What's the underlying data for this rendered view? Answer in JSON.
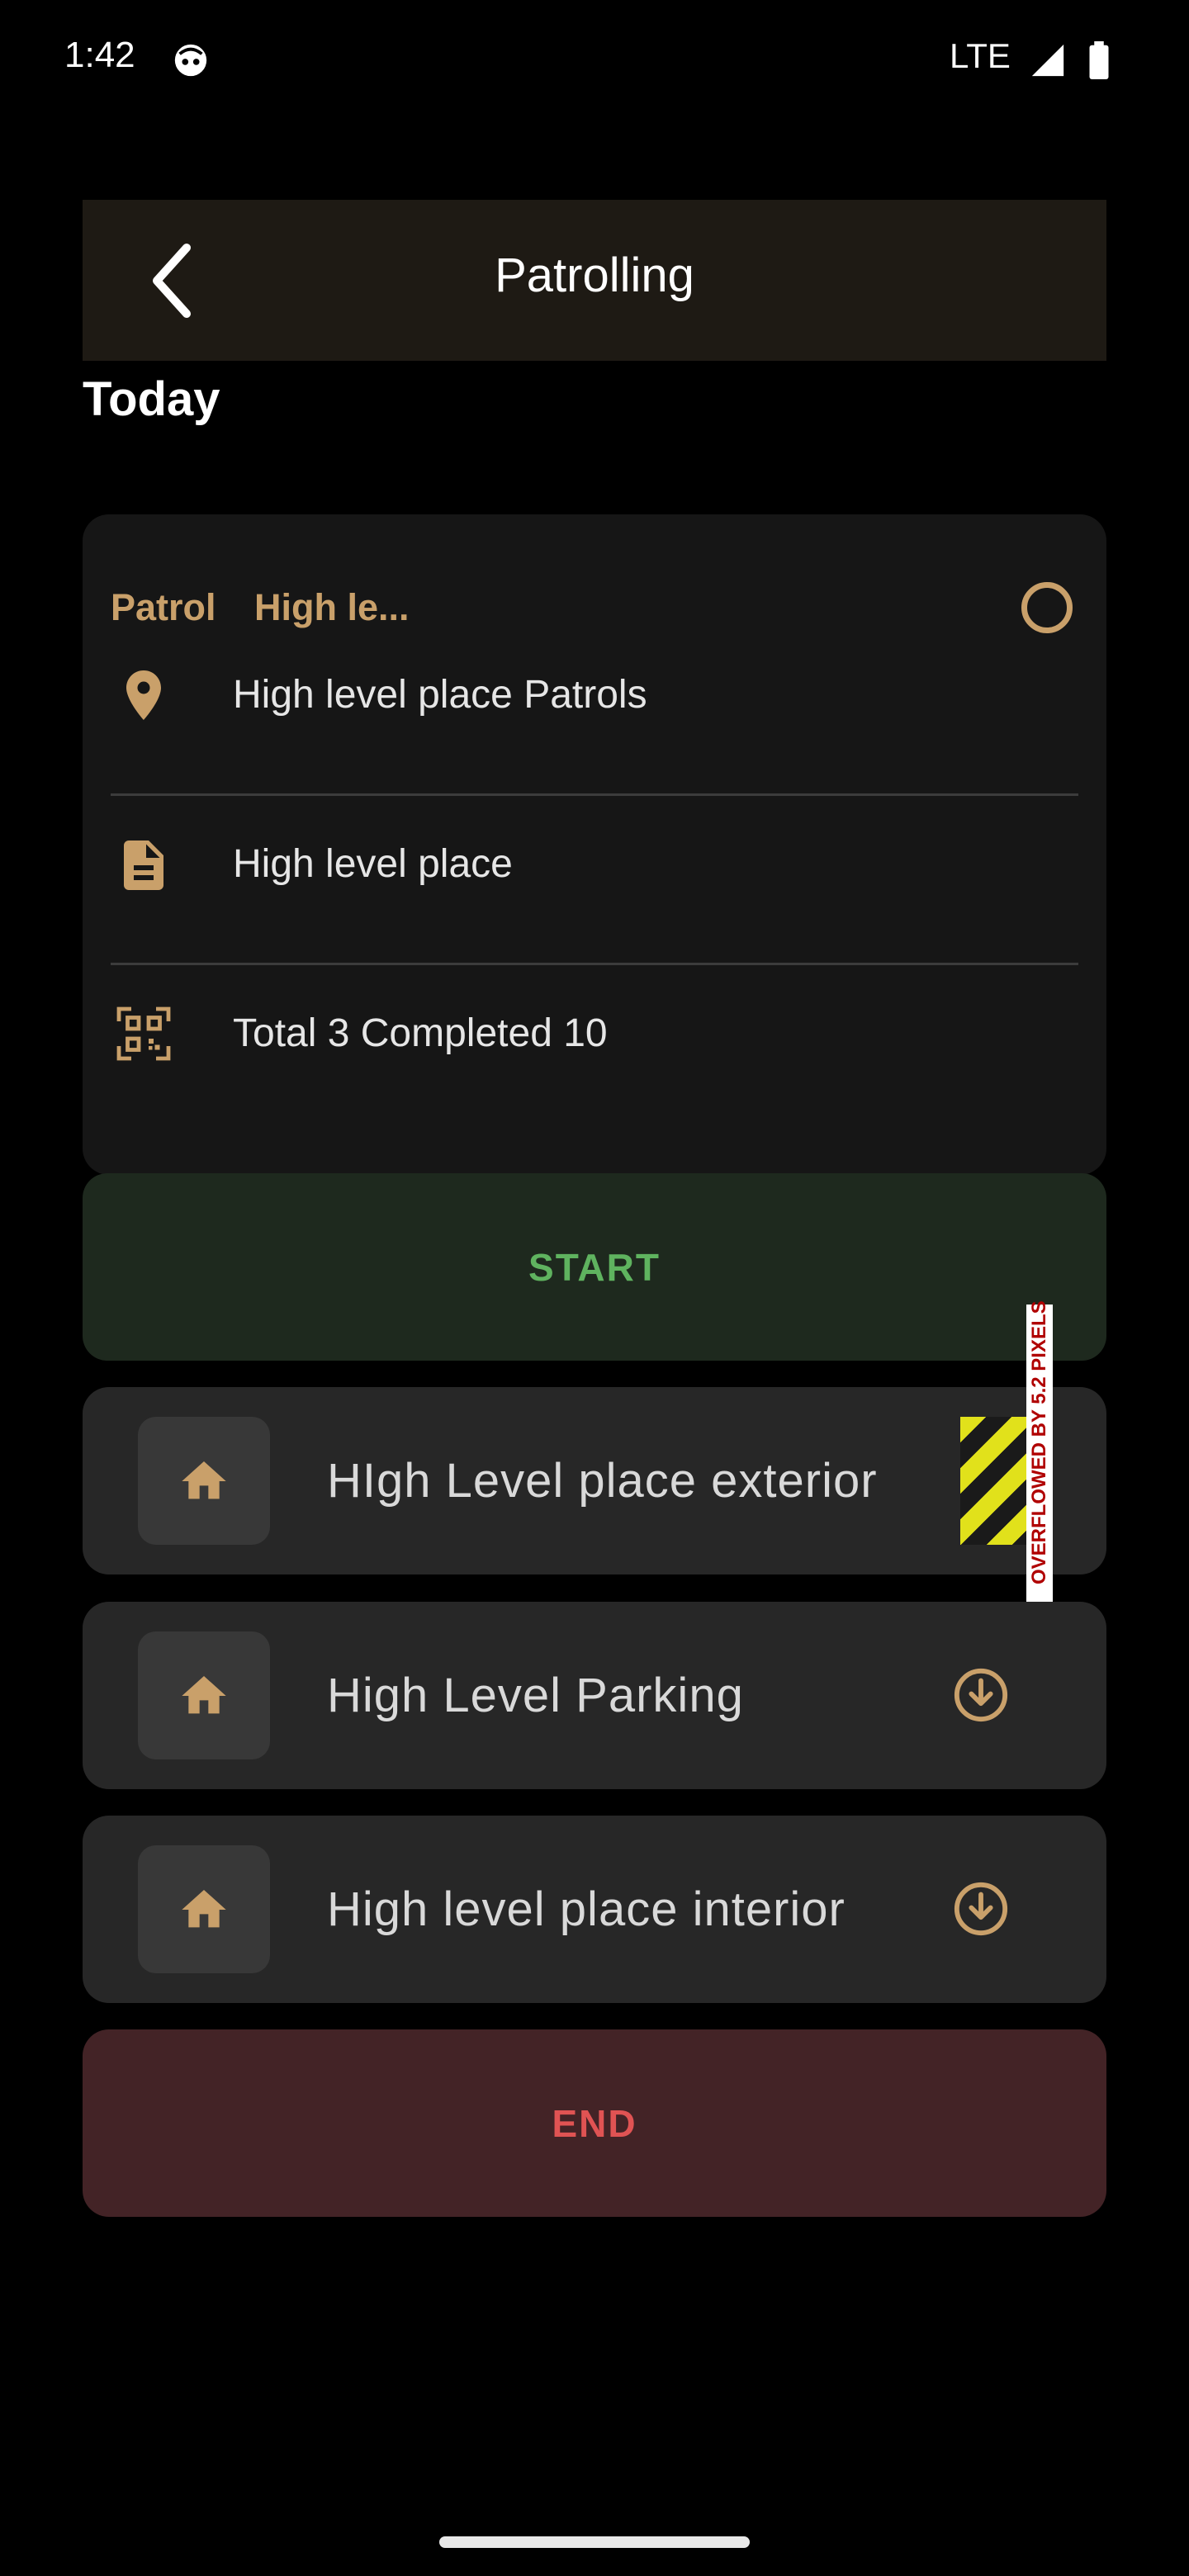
{
  "status_bar": {
    "time": "1:42",
    "network": "LTE"
  },
  "app_bar": {
    "title": "Patrolling",
    "back_icon": "chevron-left-icon"
  },
  "section": {
    "heading": "Today"
  },
  "patrol_card": {
    "title_prefix": "Patrol",
    "title_name": "High le...",
    "location": "High level place Patrols",
    "description": "High level place",
    "counts": "Total  3  Completed 10"
  },
  "buttons": {
    "start_label": "START",
    "end_label": "END"
  },
  "places": [
    {
      "label": "HIgh Level place exterior",
      "icon": "home-icon",
      "action_icon": "download-circle-icon"
    },
    {
      "label": "High Level Parking",
      "icon": "home-icon",
      "action_icon": "download-circle-icon"
    },
    {
      "label": "High level place interior",
      "icon": "home-icon",
      "action_icon": "download-circle-icon"
    }
  ],
  "debug_overlay": {
    "text": "OVERFLOWED BY 5.2 PIXELS"
  },
  "colors": {
    "accent": "#c9a06a",
    "start": "#5fb35f",
    "end": "#e05353"
  }
}
